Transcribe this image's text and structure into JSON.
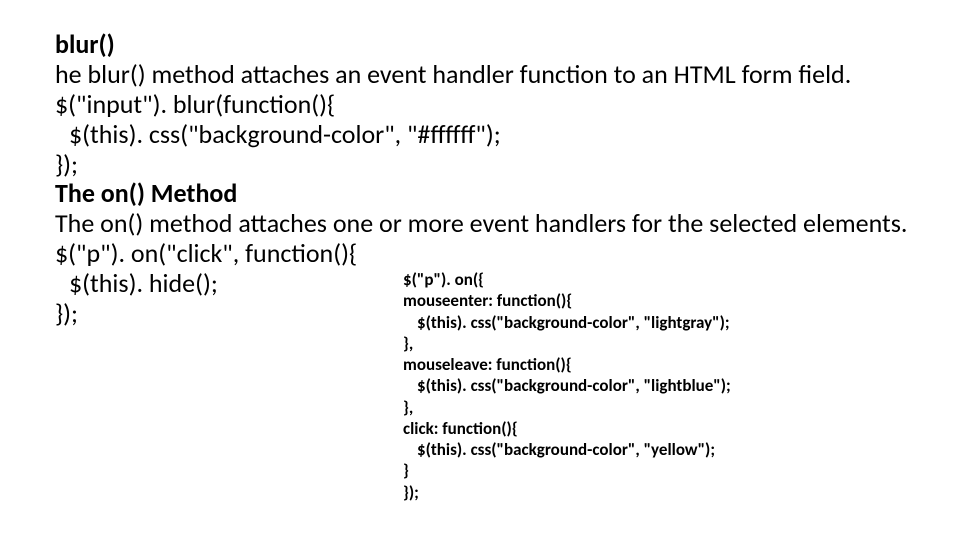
{
  "main": {
    "heading1": "blur()",
    "desc1": "he blur() method attaches an event handler function to an HTML form field.",
    "code1_l1": "$(\"input\"). blur(function(){",
    "code1_l2": "$(this). css(\"background-color\", \"#ffffff\");",
    "code1_l3": "});",
    "heading2": "The on() Method",
    "desc2": "The on() method attaches one or more event handlers for the selected elements.",
    "code2_l1": "$(\"p\"). on(\"click\", function(){",
    "code2_l2": "$(this). hide();",
    "code2_l3": "});"
  },
  "side": {
    "l1": "$(\"p\"). on({",
    "l2a": "mouseenter: ",
    "l2b": "function(){",
    "l3": "$(this). css(\"background-color\", \"lightgray\");",
    "l4": "},",
    "l5a": "mouseleave: ",
    "l5b": "function(){",
    "l6": "$(this). css(\"background-color\", \"lightblue\");",
    "l7": "},",
    "l8a": "click: ",
    "l8b": "function(){",
    "l9": "$(this). css(\"background-color\", \"yellow\");",
    "l10": "}",
    "l11": "});"
  }
}
